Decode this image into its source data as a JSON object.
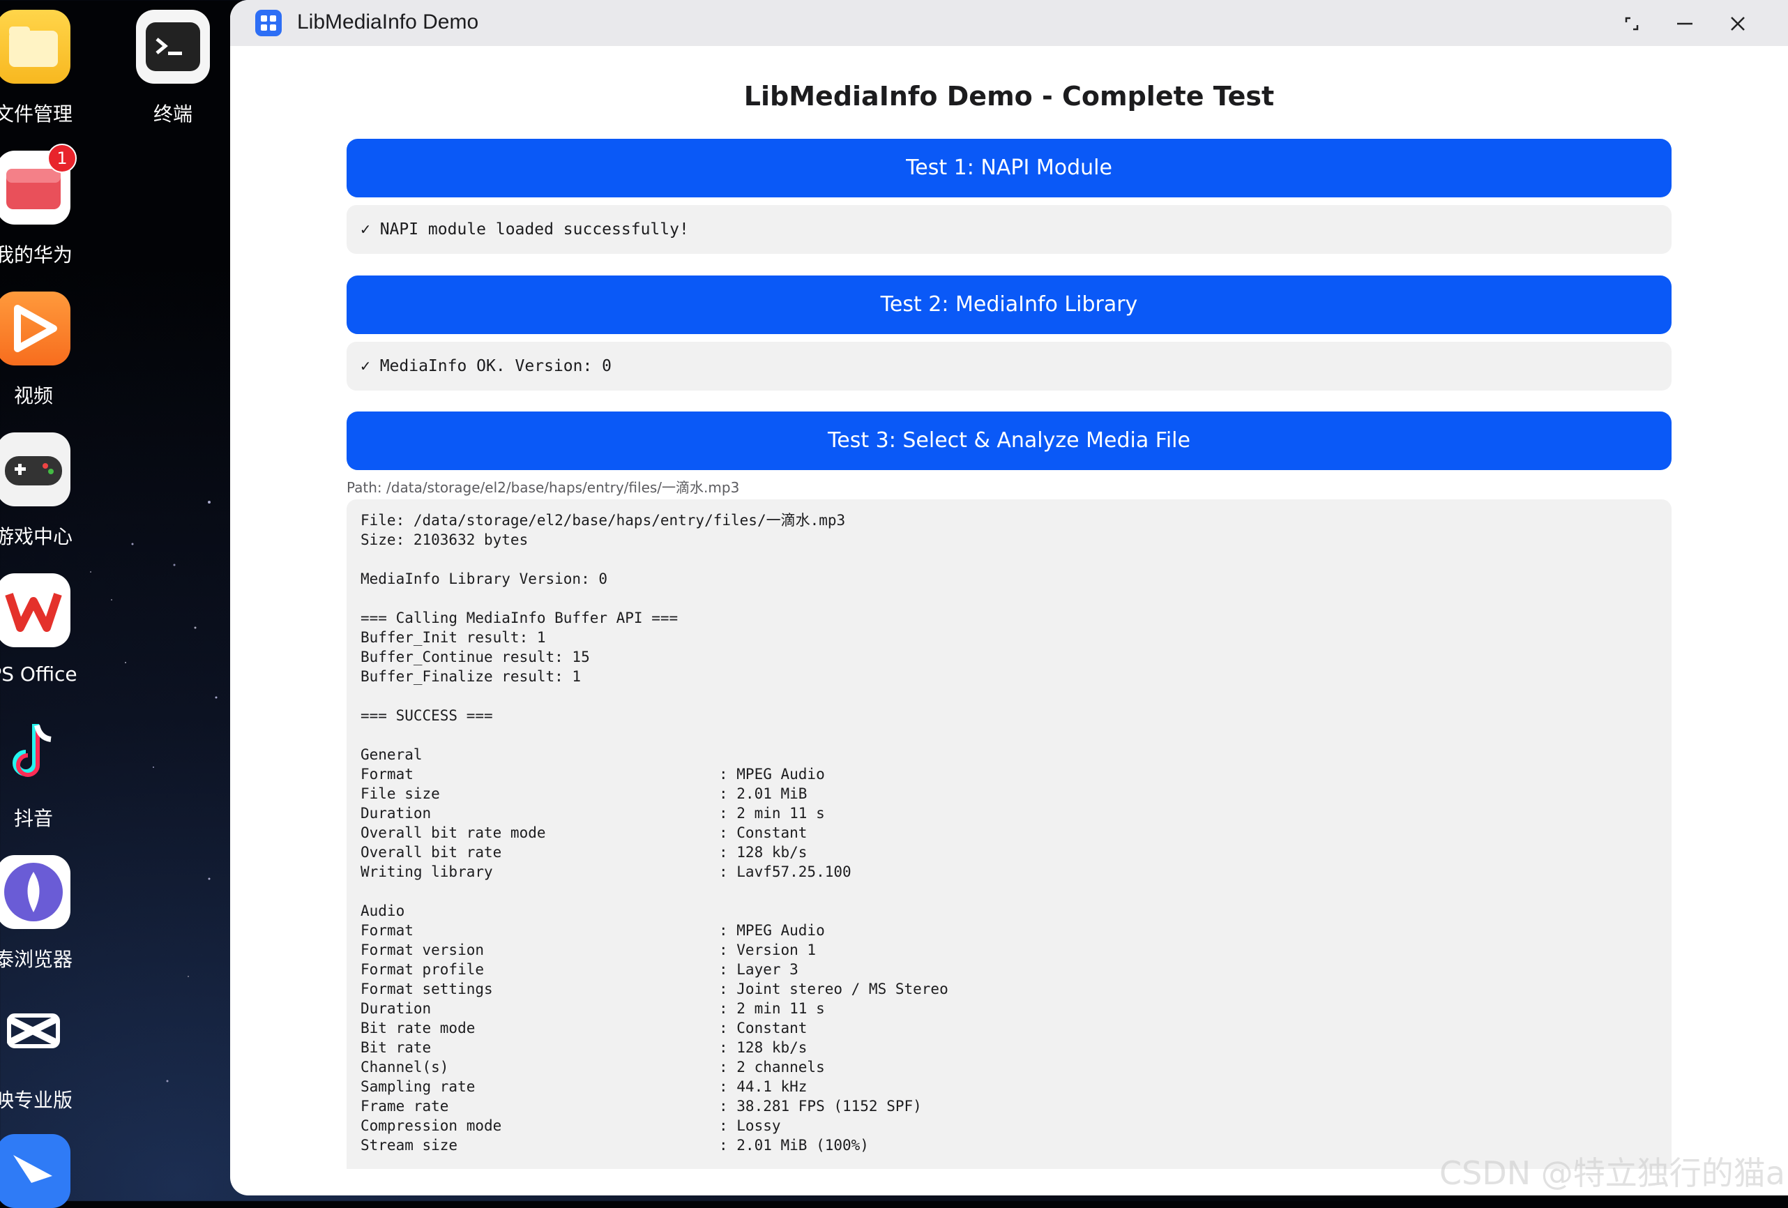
{
  "desktop": {
    "apps": [
      {
        "label": "文件管理",
        "icon": "folder-icon"
      },
      {
        "label": "终端",
        "icon": "terminal-icon"
      },
      {
        "label": "我的华为",
        "icon": "huawei-gift-icon",
        "badge": "1"
      },
      {
        "label": "视频",
        "icon": "video-play-icon"
      },
      {
        "label": "游戏中心",
        "icon": "gamepad-icon"
      },
      {
        "label": "PS Office",
        "icon": "wps-icon"
      },
      {
        "label": "抖音",
        "icon": "tiktok-icon"
      },
      {
        "label": "泰浏览器",
        "icon": "browser-icon"
      },
      {
        "label": "映专业版",
        "icon": "capcut-icon"
      },
      {
        "label": "",
        "icon": "feishu-icon"
      }
    ]
  },
  "window": {
    "title": "LibMediaInfo Demo",
    "controls": [
      "restore-icon",
      "minimize-icon",
      "close-icon"
    ]
  },
  "page": {
    "title": "LibMediaInfo Demo - Complete Test",
    "test1": {
      "button": "Test 1: NAPI Module",
      "result": "✓ NAPI module loaded successfully!"
    },
    "test2": {
      "button": "Test 2: MediaInfo Library",
      "result": "✓ MediaInfo OK. Version: 0"
    },
    "test3": {
      "button": "Test 3: Select & Analyze Media File",
      "path": "Path: /data/storage/el2/base/haps/entry/files/一滴水.mp3"
    },
    "output": {
      "header_lines": [
        "File: /data/storage/el2/base/haps/entry/files/一滴水.mp3",
        "Size: 2103632 bytes",
        "",
        "MediaInfo Library Version: 0",
        "",
        "=== Calling MediaInfo Buffer API ===",
        "Buffer_Init result: 1",
        "Buffer_Continue result: 15",
        "Buffer_Finalize result: 1",
        "",
        "=== SUCCESS ===",
        ""
      ],
      "general_title": "General",
      "general": [
        {
          "key": "Format",
          "value": ": MPEG Audio"
        },
        {
          "key": "File size",
          "value": ": 2.01 MiB"
        },
        {
          "key": "Duration",
          "value": ": 2 min 11 s"
        },
        {
          "key": "Overall bit rate mode",
          "value": ": Constant"
        },
        {
          "key": "Overall bit rate",
          "value": ": 128 kb/s"
        },
        {
          "key": "Writing library",
          "value": ": Lavf57.25.100"
        }
      ],
      "audio_title": "Audio",
      "audio": [
        {
          "key": "Format",
          "value": ": MPEG Audio"
        },
        {
          "key": "Format version",
          "value": ": Version 1"
        },
        {
          "key": "Format profile",
          "value": ": Layer 3"
        },
        {
          "key": "Format settings",
          "value": ": Joint stereo / MS Stereo"
        },
        {
          "key": "Duration",
          "value": ": 2 min 11 s"
        },
        {
          "key": "Bit rate mode",
          "value": ": Constant"
        },
        {
          "key": "Bit rate",
          "value": ": 128 kb/s"
        },
        {
          "key": "Channel(s)",
          "value": ": 2 channels"
        },
        {
          "key": "Sampling rate",
          "value": ": 44.1 kHz"
        },
        {
          "key": "Frame rate",
          "value": ": 38.281 FPS (1152 SPF)"
        },
        {
          "key": "Compression mode",
          "value": ": Lossy"
        },
        {
          "key": "Stream size",
          "value": ": 2.01 MiB (100%)"
        }
      ]
    }
  },
  "watermark": "CSDN @特立独行的猫a",
  "colors": {
    "accent": "#0a59f7",
    "result_bg": "#f1f1f1",
    "titlebar": "#e9e9ec"
  }
}
